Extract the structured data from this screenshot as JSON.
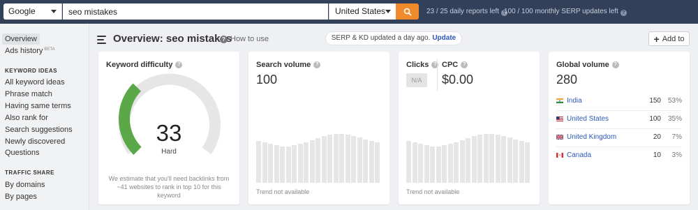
{
  "topbar": {
    "engine": "Google",
    "keyword": "seo mistakes",
    "country": "United States",
    "daily_reports": "23 / 25 daily reports left",
    "serp_updates": "100 / 100 monthly SERP updates left"
  },
  "sidebar": {
    "overview": "Overview",
    "ads_history": "Ads history",
    "beta": "BETA",
    "keyword_ideas_heading": "KEYWORD IDEAS",
    "keyword_ideas": [
      "All keyword ideas",
      "Phrase match",
      "Having same terms",
      "Also rank for",
      "Search suggestions",
      "Newly discovered",
      "Questions"
    ],
    "traffic_share_heading": "TRAFFIC SHARE",
    "traffic_share": [
      "By domains",
      "By pages"
    ]
  },
  "header": {
    "title": "Overview: seo mistakes",
    "how_to_use": "How to use",
    "update_notice": "SERP & KD updated a day ago.",
    "update_link": "Update",
    "add_to": "Add to"
  },
  "kd": {
    "title": "Keyword difficulty",
    "score": "33",
    "level": 0.33,
    "label": "Hard",
    "note": "We estimate that you'll need backlinks from ~41 websites to rank in top 10 for this keyword"
  },
  "search_volume": {
    "title": "Search volume",
    "value": "100",
    "trend_note": "Trend not available"
  },
  "clicks": {
    "title": "Clicks",
    "value": "N/A",
    "cpc_title": "CPC",
    "cpc_value": "$0.00",
    "trend_note": "Trend not available"
  },
  "global_volume": {
    "title": "Global volume",
    "value": "280",
    "rows": [
      {
        "country": "India",
        "volume": "150",
        "pct": "53%",
        "flag": "india-flag"
      },
      {
        "country": "United States",
        "volume": "100",
        "pct": "35%",
        "flag": "us-flag"
      },
      {
        "country": "United Kingdom",
        "volume": "20",
        "pct": "7%",
        "flag": "uk-flag"
      },
      {
        "country": "Canada",
        "volume": "10",
        "pct": "3%",
        "flag": "canada-flag"
      }
    ]
  },
  "colors": {
    "topbar": "#32405a",
    "accent_orange": "#f1892d",
    "link_blue": "#2a57b8",
    "gauge_green": "#5aa847"
  }
}
